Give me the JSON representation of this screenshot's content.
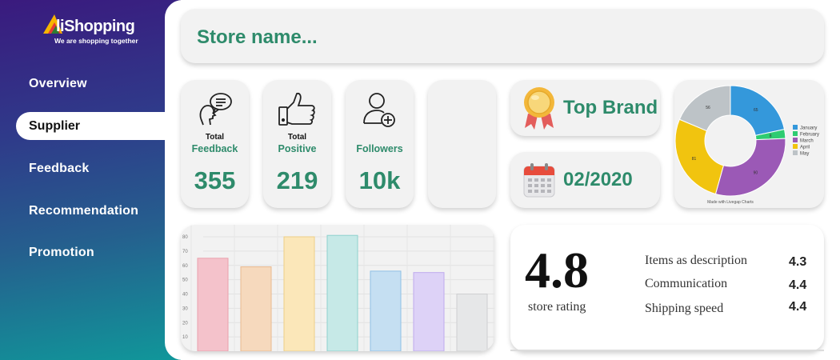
{
  "brand": {
    "name": "liShopping",
    "tagline": "We are shopping together"
  },
  "sidebar": {
    "items": [
      {
        "label": "Overview"
      },
      {
        "label": "Supplier",
        "active": true
      },
      {
        "label": "Feedback"
      },
      {
        "label": "Recommendation"
      },
      {
        "label": "Promotion"
      }
    ]
  },
  "store": {
    "name_placeholder": "Store name..."
  },
  "stats": [
    {
      "line1": "Total",
      "line2": "Feedback",
      "value": "355",
      "icon": "speech-bubble-person-icon"
    },
    {
      "line1": "Total",
      "line2": "Positive",
      "value": "219",
      "icon": "thumbs-up-icon"
    },
    {
      "line1": "",
      "line2": "Followers",
      "value": "10k",
      "icon": "add-user-icon"
    }
  ],
  "badges": {
    "top_brand": {
      "label": "Top Brand",
      "icon": "medal-icon"
    },
    "since": {
      "label": "02/2020",
      "icon": "calendar-icon"
    }
  },
  "pie_chart": {
    "type": "pie",
    "slices": [
      {
        "label": "January",
        "value": 65,
        "color": "#3498db"
      },
      {
        "label": "February",
        "value": 8,
        "color": "#2ecc71"
      },
      {
        "label": "March",
        "value": 90,
        "color": "#9b59b6"
      },
      {
        "label": "April",
        "value": 81,
        "color": "#f1c40f"
      },
      {
        "label": "May",
        "value": 56,
        "color": "#bdc3c7"
      }
    ],
    "footer": "Made with Livegap Charts"
  },
  "chart_data": {
    "type": "bar",
    "values": [
      65,
      59,
      80,
      81,
      56,
      55,
      40
    ],
    "colors": [
      "#f4c2cb",
      "#f6d9bd",
      "#fbe7b9",
      "#c6e9e7",
      "#c5dff2",
      "#ddd2f7",
      "#e6e7e8"
    ],
    "borders": [
      "#eaa0ad",
      "#e9b98f",
      "#edcf86",
      "#8fd1cd",
      "#8fc0e5",
      "#bfaaee",
      "#cfcfd1"
    ],
    "yticks": [
      10,
      20,
      30,
      40,
      50,
      60,
      70,
      80
    ],
    "ylim": [
      0,
      90
    ],
    "grid": true
  },
  "rating": {
    "score": "4.8",
    "label": "store rating",
    "rows": [
      {
        "label": "Items as description",
        "value": "4.3"
      },
      {
        "label": "Communication",
        "value": "4.4"
      },
      {
        "label": "Shipping speed",
        "value": "4.4"
      }
    ]
  }
}
